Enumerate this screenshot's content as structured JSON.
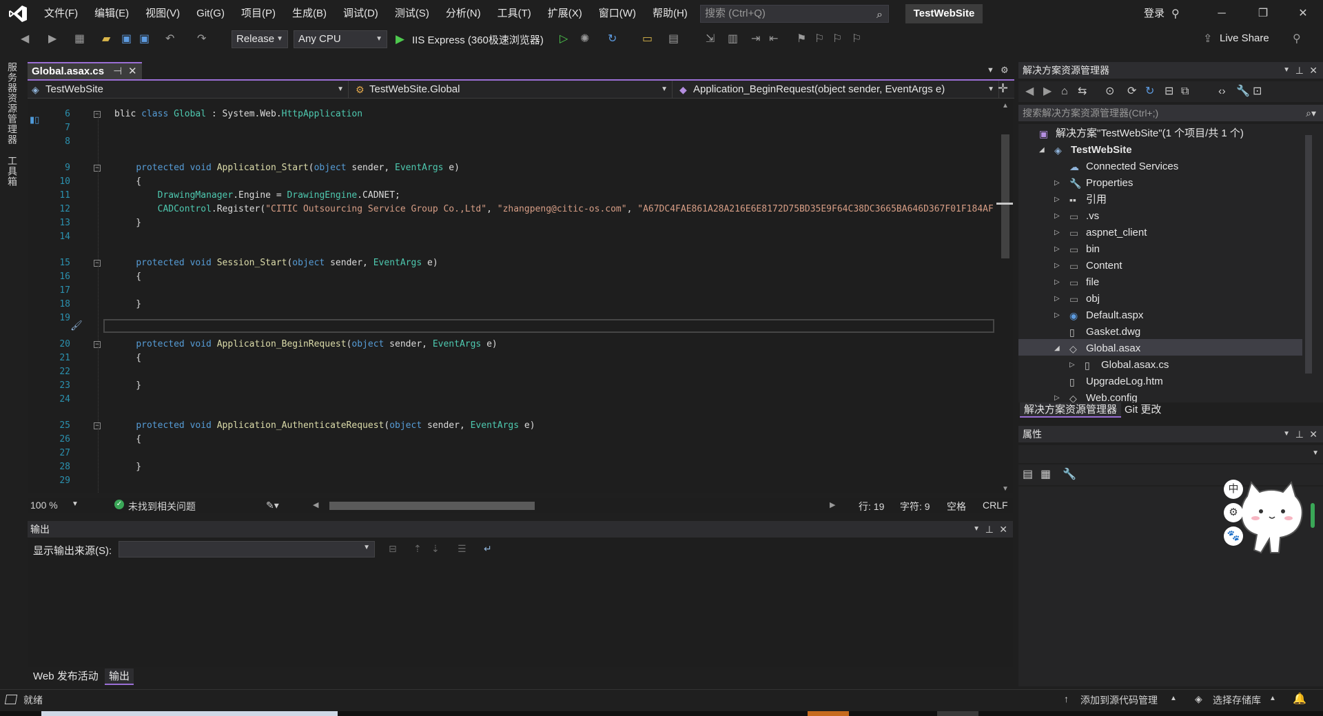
{
  "menubar": {
    "items": [
      "文件(F)",
      "编辑(E)",
      "视图(V)",
      "Git(G)",
      "项目(P)",
      "生成(B)",
      "调试(D)",
      "测试(S)",
      "分析(N)",
      "工具(T)",
      "扩展(X)",
      "窗口(W)",
      "帮助(H)"
    ],
    "search_placeholder": "搜索 (Ctrl+Q)",
    "solution_name": "TestWebSite",
    "login": "登录"
  },
  "toolbar": {
    "configuration": "Release",
    "platform": "Any CPU",
    "run_target": "IIS Express (360极速浏览器)",
    "live_share": "Live Share"
  },
  "left_strip": {
    "server_explorer": "服务器资源管理器",
    "toolbox": "工具箱"
  },
  "editor": {
    "tab_title": "Global.asax.cs",
    "nav_project": "TestWebSite",
    "nav_class": "TestWebSite.Global",
    "nav_member": "Application_BeginRequest(object sender, EventArgs e)",
    "zoom": "100 %",
    "issues": "未找到相关问题",
    "line": "行: 19",
    "char": "字符: 9",
    "whitespace": "空格",
    "line_ending": "CRLF",
    "lines": [
      {
        "n": "6",
        "fold": true,
        "tokens": [
          [
            "plain",
            "blic "
          ],
          [
            "kw",
            "class "
          ],
          [
            "ty",
            "Global"
          ],
          [
            "plain",
            " : System.Web."
          ],
          [
            "ty",
            "HttpApplication"
          ]
        ]
      },
      {
        "n": "7",
        "fold": false,
        "tokens": []
      },
      {
        "n": "8",
        "fold": false,
        "tokens": []
      },
      {
        "n": "9",
        "fold": true,
        "tokens": [
          [
            "plain",
            "    "
          ],
          [
            "kw",
            "protected void "
          ],
          [
            "fn",
            "Application_Start"
          ],
          [
            "plain",
            "("
          ],
          [
            "kw",
            "object"
          ],
          [
            "plain",
            " sender, "
          ],
          [
            "ty",
            "EventArgs"
          ],
          [
            "plain",
            " e)"
          ]
        ]
      },
      {
        "n": "10",
        "fold": false,
        "tokens": [
          [
            "plain",
            "    {"
          ]
        ]
      },
      {
        "n": "11",
        "fold": false,
        "tokens": [
          [
            "plain",
            "        "
          ],
          [
            "ty",
            "DrawingManager"
          ],
          [
            "plain",
            ".Engine = "
          ],
          [
            "ty",
            "DrawingEngine"
          ],
          [
            "plain",
            ".CADNET;"
          ]
        ]
      },
      {
        "n": "12",
        "fold": false,
        "tokens": [
          [
            "plain",
            "        "
          ],
          [
            "ty",
            "CADControl"
          ],
          [
            "plain",
            ".Register("
          ],
          [
            "str",
            "\"CITIC Outsourcing Service Group Co.,Ltd\""
          ],
          [
            "plain",
            ", "
          ],
          [
            "str",
            "\"zhangpeng@citic-os.com\""
          ],
          [
            "plain",
            ", "
          ],
          [
            "str",
            "\"A67DC4FAE861A28A216E6E8172D75BD35E9F64C38DC3665BA646D367F01F184AF"
          ]
        ]
      },
      {
        "n": "13",
        "fold": false,
        "tokens": [
          [
            "plain",
            "    }"
          ]
        ]
      },
      {
        "n": "14",
        "fold": false,
        "tokens": []
      },
      {
        "n": "15",
        "fold": true,
        "tokens": [
          [
            "plain",
            "    "
          ],
          [
            "kw",
            "protected void "
          ],
          [
            "fn",
            "Session_Start"
          ],
          [
            "plain",
            "("
          ],
          [
            "kw",
            "object"
          ],
          [
            "plain",
            " sender, "
          ],
          [
            "ty",
            "EventArgs"
          ],
          [
            "plain",
            " e)"
          ]
        ]
      },
      {
        "n": "16",
        "fold": false,
        "tokens": [
          [
            "plain",
            "    {"
          ]
        ]
      },
      {
        "n": "17",
        "fold": false,
        "tokens": []
      },
      {
        "n": "18",
        "fold": false,
        "tokens": [
          [
            "plain",
            "    }"
          ]
        ]
      },
      {
        "n": "19",
        "fold": false,
        "tokens": []
      },
      {
        "n": "20",
        "fold": true,
        "tokens": [
          [
            "plain",
            "    "
          ],
          [
            "kw",
            "protected void "
          ],
          [
            "fn",
            "Application_BeginRequest"
          ],
          [
            "plain",
            "("
          ],
          [
            "kw",
            "object"
          ],
          [
            "plain",
            " sender, "
          ],
          [
            "ty",
            "EventArgs"
          ],
          [
            "plain",
            " e)"
          ]
        ]
      },
      {
        "n": "21",
        "fold": false,
        "tokens": [
          [
            "plain",
            "    {"
          ]
        ]
      },
      {
        "n": "22",
        "fold": false,
        "tokens": []
      },
      {
        "n": "23",
        "fold": false,
        "tokens": [
          [
            "plain",
            "    }"
          ]
        ]
      },
      {
        "n": "24",
        "fold": false,
        "tokens": []
      },
      {
        "n": "25",
        "fold": true,
        "tokens": [
          [
            "plain",
            "    "
          ],
          [
            "kw",
            "protected void "
          ],
          [
            "fn",
            "Application_AuthenticateRequest"
          ],
          [
            "plain",
            "("
          ],
          [
            "kw",
            "object"
          ],
          [
            "plain",
            " sender, "
          ],
          [
            "ty",
            "EventArgs"
          ],
          [
            "plain",
            " e)"
          ]
        ]
      },
      {
        "n": "26",
        "fold": false,
        "tokens": [
          [
            "plain",
            "    {"
          ]
        ]
      },
      {
        "n": "27",
        "fold": false,
        "tokens": []
      },
      {
        "n": "28",
        "fold": false,
        "tokens": [
          [
            "plain",
            "    }"
          ]
        ]
      },
      {
        "n": "29",
        "fold": false,
        "tokens": []
      }
    ]
  },
  "output": {
    "title": "输出",
    "source_label": "显示输出来源(S):",
    "source_value": ""
  },
  "bottom_tabs": [
    "Web 发布活动",
    "输出"
  ],
  "solution_explorer": {
    "title": "解决方案资源管理器",
    "search_placeholder": "搜索解决方案资源管理器(Ctrl+;)",
    "tabs": [
      "解决方案资源管理器",
      "Git 更改"
    ],
    "tree": [
      {
        "label": "解决方案\"TestWebSite\"(1 个项目/共 1 个)",
        "depth": 0,
        "twisty": "",
        "icon": "solution-icon",
        "bold": false
      },
      {
        "label": "TestWebSite",
        "depth": 1,
        "twisty": "◢",
        "icon": "web-project-icon",
        "bold": true
      },
      {
        "label": "Connected Services",
        "depth": 2,
        "twisty": "",
        "icon": "connected-services-icon",
        "bold": false
      },
      {
        "label": "Properties",
        "depth": 2,
        "twisty": "▷",
        "icon": "wrench-icon",
        "bold": false
      },
      {
        "label": "引用",
        "depth": 2,
        "twisty": "▷",
        "icon": "references-icon",
        "bold": false
      },
      {
        "label": ".vs",
        "depth": 2,
        "twisty": "▷",
        "icon": "folder-icon",
        "bold": false
      },
      {
        "label": "aspnet_client",
        "depth": 2,
        "twisty": "▷",
        "icon": "folder-icon",
        "bold": false
      },
      {
        "label": "bin",
        "depth": 2,
        "twisty": "▷",
        "icon": "folder-icon",
        "bold": false
      },
      {
        "label": "Content",
        "depth": 2,
        "twisty": "▷",
        "icon": "folder-icon",
        "bold": false
      },
      {
        "label": "file",
        "depth": 2,
        "twisty": "▷",
        "icon": "folder-icon",
        "bold": false
      },
      {
        "label": "obj",
        "depth": 2,
        "twisty": "▷",
        "icon": "folder-icon",
        "bold": false
      },
      {
        "label": "Default.aspx",
        "depth": 2,
        "twisty": "▷",
        "icon": "aspx-file-icon",
        "bold": false
      },
      {
        "label": "Gasket.dwg",
        "depth": 2,
        "twisty": "",
        "icon": "file-icon",
        "bold": false
      },
      {
        "label": "Global.asax",
        "depth": 2,
        "twisty": "◢",
        "icon": "asax-file-icon",
        "bold": false
      },
      {
        "label": "Global.asax.cs",
        "depth": 3,
        "twisty": "▷",
        "icon": "cs-file-icon",
        "bold": false
      },
      {
        "label": "UpgradeLog.htm",
        "depth": 2,
        "twisty": "",
        "icon": "file-icon",
        "bold": false
      },
      {
        "label": "Web.config",
        "depth": 2,
        "twisty": "▷",
        "icon": "config-file-icon",
        "bold": false
      }
    ]
  },
  "properties": {
    "title": "属性"
  },
  "mascot": {
    "buttons": [
      "中",
      "⚙",
      "🐾"
    ]
  },
  "statusbar": {
    "ready": "就绪",
    "add_source_control": "添加到源代码管理",
    "select_repository": "选择存储库"
  },
  "colors": {
    "accent": "#9b6fd6",
    "keyword": "#569cd6",
    "type": "#4ec9b0",
    "string": "#d69d85",
    "line_number": "#2b91af"
  }
}
